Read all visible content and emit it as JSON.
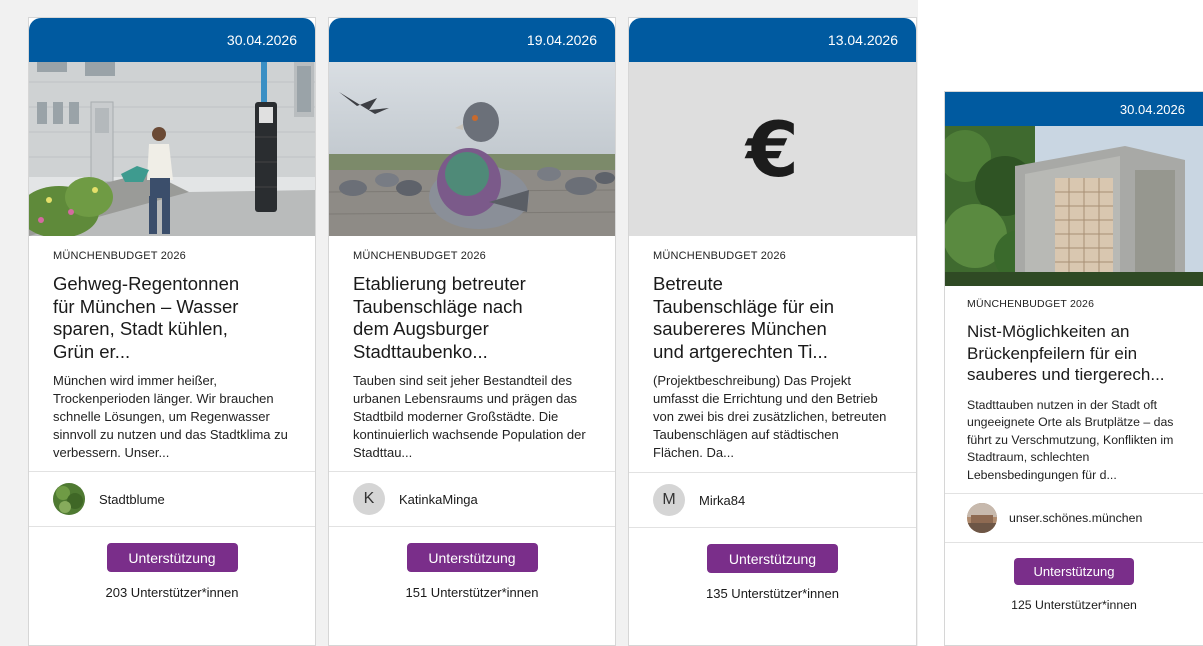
{
  "cards": [
    {
      "date": "30.04.2026",
      "category": "MÜNCHENBUDGET 2026",
      "title": "Gehweg-Regentonnen für München – Wasser sparen, Stadt kühlen, Grün er...",
      "description": " München wird immer heißer, Trockenperioden länger. Wir brauchen schnelle Lösungen, um Regenwasser sinnvoll zu nutzen und das Stadtklima zu verbessern. Unser...",
      "author": "Stadtblume",
      "support_label": "Unterstützung",
      "supporters": "203 Unterstützer*innen"
    },
    {
      "date": "19.04.2026",
      "category": "MÜNCHENBUDGET 2026",
      "title": "Etablierung betreuter Taubenschläge nach dem Augsburger Stadttaubenko...",
      "description": "Tauben sind seit jeher Bestandteil des urbanen Lebensraums und prägen das Stadtbild moderner Großstädte. Die kontinuierlich wachsende Population der Stadttau...",
      "author_initial": "K",
      "author": "KatinkaMinga",
      "support_label": "Unterstützung",
      "supporters": "151 Unterstützer*innen"
    },
    {
      "date": "13.04.2026",
      "category": "MÜNCHENBUDGET 2026",
      "image_glyph": "€",
      "title": "Betreute Taubenschläge für ein saubereres München und artgerechten Ti...",
      "description": "(Projektbeschreibung) Das Projekt umfasst die Errichtung und den Betrieb von zwei bis drei zusätzlichen, betreuten Taubenschlägen auf städtischen Flächen. Da...",
      "author_initial": "M",
      "author": "Mirka84",
      "support_label": "Unterstützung",
      "supporters": "135 Unterstützer*innen"
    },
    {
      "date": "30.04.2026",
      "category": "MÜNCHENBUDGET 2026",
      "title": "Nist-Möglichkeiten an Brückenpfeilern für ein sauberes und tiergerech...",
      "description": "Stadttauben nutzen in der Stadt oft ungeeignete Orte als Brutplätze – das führt zu Verschmutzung, Konflikten im Stadtraum, schlechten Lebensbedingungen für d...",
      "author": "unser.schönes.münchen",
      "support_label": "Unterstützung",
      "supporters": "125 Unterstützer*innen"
    }
  ],
  "colors": {
    "header": "#005aa0",
    "button": "#7a2e8a"
  },
  "icons": [
    "euro-icon"
  ]
}
